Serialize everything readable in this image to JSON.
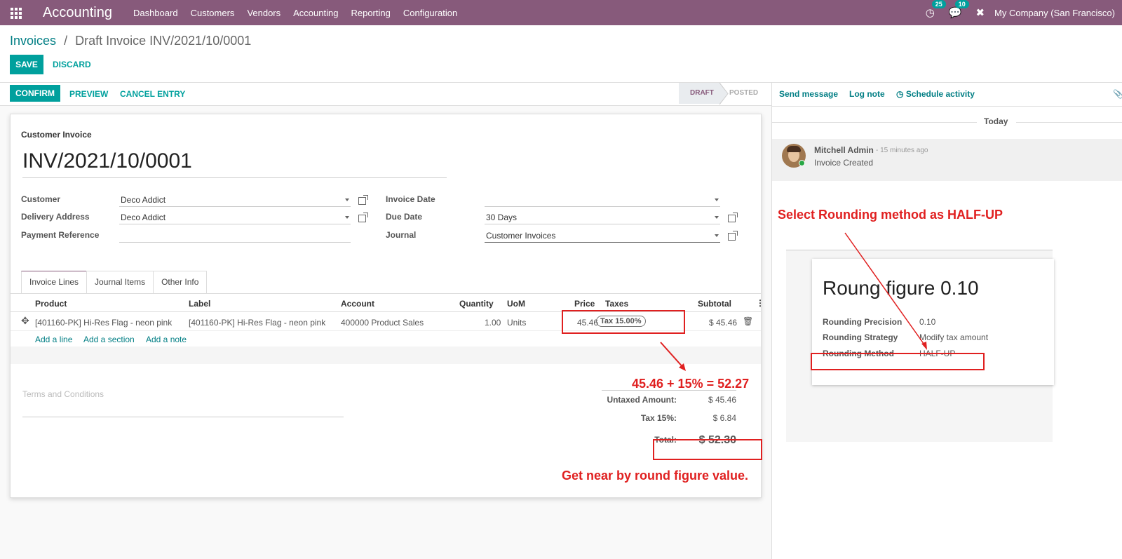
{
  "app": {
    "name": "Accounting",
    "apps_icon": "grid-icon"
  },
  "menu": [
    "Dashboard",
    "Customers",
    "Vendors",
    "Accounting",
    "Reporting",
    "Configuration"
  ],
  "systray": {
    "activity_count": "25",
    "message_count": "10",
    "company": "My Company (San Francisco)"
  },
  "breadcrumb": {
    "parent": "Invoices",
    "separator": "/",
    "current": "Draft Invoice INV/2021/10/0001"
  },
  "buttons": {
    "save": "SAVE",
    "discard": "DISCARD",
    "confirm": "CONFIRM",
    "preview": "PREVIEW",
    "cancel_entry": "CANCEL ENTRY"
  },
  "status": {
    "draft": "DRAFT",
    "posted": "POSTED"
  },
  "invoice": {
    "type_label": "Customer Invoice",
    "number": "INV/2021/10/0001",
    "customer_label": "Customer",
    "customer": "Deco Addict",
    "delivery_label": "Delivery Address",
    "delivery": "Deco Addict",
    "payment_ref_label": "Payment Reference",
    "payment_ref": "",
    "invoice_date_label": "Invoice Date",
    "invoice_date": "",
    "due_date_label": "Due Date",
    "due_date": "30 Days",
    "journal_label": "Journal",
    "journal": "Customer Invoices"
  },
  "tabs": [
    "Invoice Lines",
    "Journal Items",
    "Other Info"
  ],
  "lines": {
    "headers": [
      "Product",
      "Label",
      "Account",
      "Quantity",
      "UoM",
      "Price",
      "Taxes",
      "Subtotal"
    ],
    "rows": [
      {
        "product": "[401160-PK] Hi-Res Flag - neon pink",
        "label": "[401160-PK] Hi-Res Flag - neon pink",
        "account": "400000 Product Sales",
        "quantity": "1.00",
        "uom": "Units",
        "price": "45.46",
        "tax": "Tax 15.00%",
        "subtotal": "$ 45.46"
      }
    ],
    "add_line": "Add a line",
    "add_section": "Add a section",
    "add_note": "Add a note"
  },
  "terms_placeholder": "Terms and Conditions",
  "totals": {
    "untaxed_label": "Untaxed Amount:",
    "untaxed": "$ 45.46",
    "tax_label": "Tax 15%:",
    "tax": "$ 6.84",
    "total_label": "Total:",
    "total": "$ 52.30"
  },
  "annotations": {
    "calc": "45.46 + 15% = 52.27",
    "round_note": "Get near by round figure value.",
    "select_note": "Select Rounding method as HALF-UP",
    "annotation_color": "#e02020"
  },
  "chatter": {
    "send_message": "Send message",
    "log_note": "Log note",
    "schedule_activity": "Schedule activity",
    "today": "Today",
    "author": "Mitchell Admin",
    "time": "- 15 minutes ago",
    "body": "Invoice Created"
  },
  "rounding": {
    "title": "Roung figure 0.10",
    "precision_label": "Rounding Precision",
    "precision": "0.10",
    "strategy_label": "Rounding Strategy",
    "strategy": "Modify tax amount",
    "method_label": "Rounding Method",
    "method": "HALF-UP"
  },
  "colors": {
    "navbar": "#875a7b",
    "primary": "#00a09d",
    "link": "#017e84"
  }
}
